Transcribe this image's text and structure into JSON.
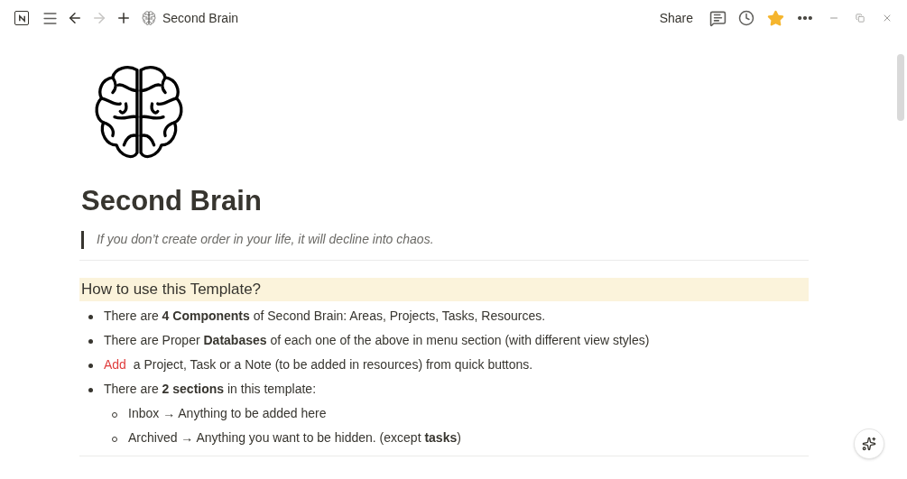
{
  "topbar": {
    "breadcrumb": "Second Brain",
    "back_disabled": false,
    "forward_disabled": true,
    "share": "Share",
    "favorite": true
  },
  "page": {
    "title": "Second Brain",
    "quote": "If you don’t create order in your life, it will decline into chaos.",
    "callout": {
      "heading": "How to use this Template?"
    },
    "bullets": [
      {
        "kind": "plain",
        "text": "There are **4 Components** of Second Brain:  Areas, Projects, Tasks, Resources."
      },
      {
        "kind": "plain",
        "text": "There are Proper **Databases** of each one of the above in menu section (with different view styles)"
      },
      {
        "kind": "accent",
        "accent": "Add",
        "text": "a Project, Task or a Note (to be added in resources) from quick buttons."
      },
      {
        "kind": "plain",
        "text": "There are **2 sections** in this template:",
        "children": [
          {
            "kind": "plain",
            "text": "Inbox → Anything to be added here"
          },
          {
            "kind": "plain",
            "text": "Archived → Anything you want to be hidden. (except **tasks**)"
          }
        ]
      }
    ]
  }
}
